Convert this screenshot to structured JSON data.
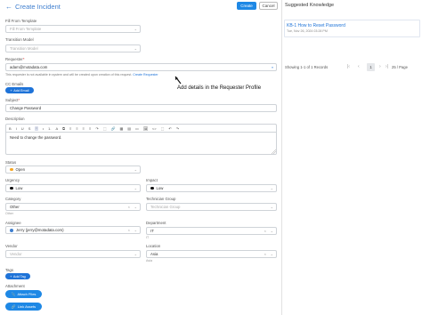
{
  "header": {
    "back_icon": "arrow-left-icon",
    "title": "Create Incident",
    "create_label": "Create",
    "cancel_label": "Cancel"
  },
  "knowledge": {
    "title": "Suggested Knowledge",
    "article_title": "KB-1 How to Reset Password",
    "article_meta": "Tue, Nov 26, 2024 03:28 PM",
    "pagination": {
      "summary": "Showing 1-1 of 1 Records",
      "current_page": "1",
      "page_size": "25 / Page",
      "first_icon": "first-page-icon",
      "prev_icon": "chevron-left-icon",
      "next_icon": "chevron-right-icon",
      "last_icon": "last-page-icon"
    }
  },
  "form": {
    "template": {
      "label": "Fill From Template",
      "placeholder": "Fill From Template"
    },
    "transition_model": {
      "label": "Transition Model",
      "placeholder": "Transition Model"
    },
    "requester": {
      "label": "Requester",
      "value": "adam@motadata.com",
      "note": "This requester is not available in system and will be created upon creation of this request.",
      "note_link": "Create Requester"
    },
    "tooltip": "Add details in the Requester Profile",
    "cc_emails": {
      "label": "CC Emails",
      "add_label": "Add Email"
    },
    "subject": {
      "label": "Subject",
      "value": "Change Password"
    },
    "description": {
      "label": "Description",
      "value": "Need to change the password.",
      "toolbar": [
        "B",
        "I",
        "U",
        "S",
        "“",
        "•",
        "1.",
        "A",
        "⧉",
        "≡",
        "≡",
        "≡",
        "≡",
        "↷",
        "⬚",
        "🔗",
        "▦",
        "▤",
        "▭",
        "🖼",
        "<>",
        "⬚",
        "↶",
        "↷"
      ]
    },
    "status": {
      "label": "Status",
      "value": "Open",
      "color": "#f5a623"
    },
    "urgency": {
      "label": "Urgency",
      "value": "Low",
      "color": "#111111"
    },
    "impact": {
      "label": "Impact",
      "value": "Low",
      "color": "#111111"
    },
    "category": {
      "label": "Category",
      "value": "Other",
      "sub": "Other"
    },
    "technician_group": {
      "label": "Technician Group",
      "placeholder": "Technician Group"
    },
    "assignee": {
      "label": "Assignee",
      "value": "Jerry (jerry@motadata.com)"
    },
    "department": {
      "label": "Department",
      "value": "IT",
      "sub": "IT"
    },
    "vendor": {
      "label": "Vendor",
      "placeholder": "Vendor"
    },
    "location": {
      "label": "Location",
      "value": "Asia",
      "sub": "Asia"
    },
    "tags": {
      "label": "Tags",
      "add_label": "Add Tag"
    },
    "attachment": {
      "label": "Attachment",
      "attach_label": "Attach Files",
      "link_label": "Link Assets"
    }
  },
  "colors": {
    "accent": "#1e88e5",
    "link": "#1e73d8"
  }
}
